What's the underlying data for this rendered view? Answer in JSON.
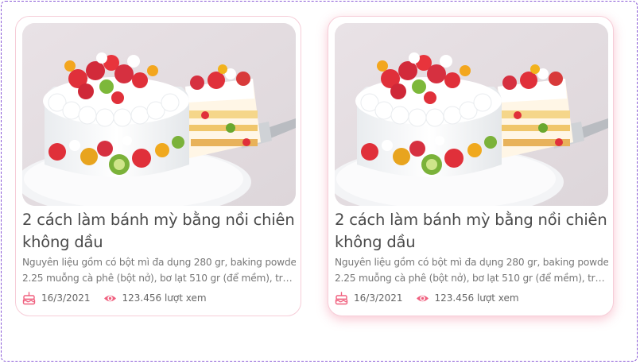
{
  "colors": {
    "accent": "#f0607f",
    "card_border": "#f6cdd8",
    "frame": "#8a5ad6"
  },
  "cards": [
    {
      "image": "strawberry-fruit-cake-photo",
      "title_line1": "2 cách làm bánh mỳ bằng nồi chiên",
      "title_line2": "không dầu",
      "desc_line1": "Nguyên liệu gồm có bột mì đa dụng 280 gr, baking powder",
      "desc_line2": "2.25 muỗng cà phê (bột nở), bơ lạt 510 gr (để mềm),  trứng gà",
      "date_icon": "cake-icon",
      "date": "16/3/2021",
      "views_icon": "eye-icon",
      "views": "123.456 lượt xem"
    },
    {
      "image": "strawberry-fruit-cake-photo",
      "title_line1": "2 cách làm bánh mỳ bằng nồi chiên",
      "title_line2": "không dầu",
      "desc_line1": "Nguyên liệu gồm có bột mì đa dụng 280 gr, baking powder",
      "desc_line2": "2.25 muỗng cà phê (bột nở), bơ lạt 510 gr (để mềm),  trứng gà",
      "date_icon": "cake-icon",
      "date": "16/3/2021",
      "views_icon": "eye-icon",
      "views": "123.456 lượt xem"
    }
  ]
}
